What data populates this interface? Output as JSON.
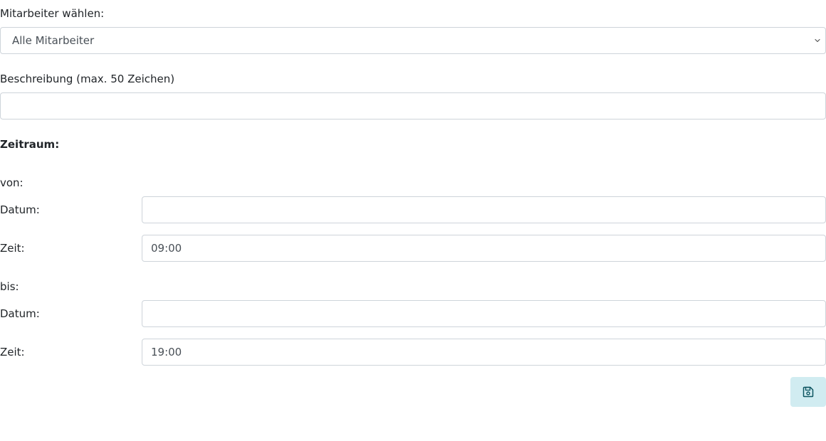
{
  "employee": {
    "label": "Mitarbeiter wählen:",
    "selected": "Alle Mitarbeiter"
  },
  "description": {
    "label": "Beschreibung (max. 50 Zeichen)",
    "value": ""
  },
  "period": {
    "heading": "Zeitraum:",
    "from": {
      "heading": "von:",
      "date_label": "Datum:",
      "date_value": "",
      "time_label": "Zeit:",
      "time_value": "09:00"
    },
    "to": {
      "heading": "bis:",
      "date_label": "Datum:",
      "date_value": "",
      "time_label": "Zeit:",
      "time_value": "19:00"
    }
  },
  "save_button": {
    "icon": "floppy-disk-icon",
    "color": "#0c5460",
    "background": "#d1ecf1"
  }
}
